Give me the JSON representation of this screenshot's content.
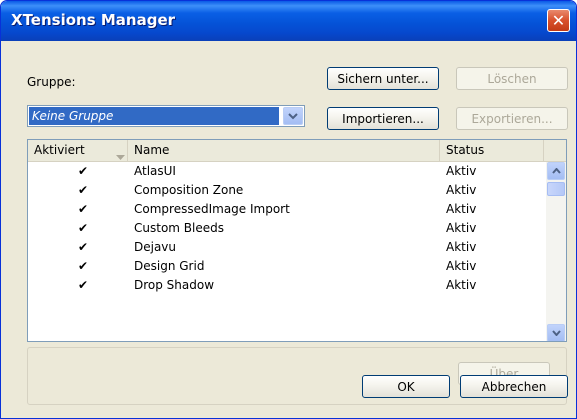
{
  "window": {
    "title": "XTensions Manager",
    "close_glyph": "✕"
  },
  "group": {
    "label": "Gruppe:",
    "selected": "Keine Gruppe"
  },
  "buttons": {
    "save_as": "Sichern unter...",
    "delete": "Löschen",
    "import": "Importieren...",
    "export": "Exportieren...",
    "about": "Über",
    "ok": "OK",
    "cancel": "Abbrechen"
  },
  "list": {
    "columns": {
      "activated": "Aktiviert",
      "name": "Name",
      "status": "Status"
    },
    "rows": [
      {
        "check": "✔",
        "name": "AtlasUI",
        "status": "Aktiv"
      },
      {
        "check": "✔",
        "name": "Composition Zone",
        "status": "Aktiv"
      },
      {
        "check": "✔",
        "name": "CompressedImage Import",
        "status": "Aktiv"
      },
      {
        "check": "✔",
        "name": "Custom Bleeds",
        "status": "Aktiv"
      },
      {
        "check": "✔",
        "name": "Dejavu",
        "status": "Aktiv"
      },
      {
        "check": "✔",
        "name": "Design Grid",
        "status": "Aktiv"
      },
      {
        "check": "✔",
        "name": "Drop Shadow",
        "status": "Aktiv"
      }
    ]
  },
  "icons": {
    "close": "close-icon",
    "dropdown": "chevron-down-icon",
    "sort": "sort-arrow-icon",
    "scroll_up": "scroll-up-icon",
    "scroll_down": "scroll-down-icon"
  },
  "colors": {
    "titlebar": "#0553d8",
    "selection": "#316ac5",
    "dialog_bg": "#ece9d8",
    "close_button": "#d8502c"
  }
}
